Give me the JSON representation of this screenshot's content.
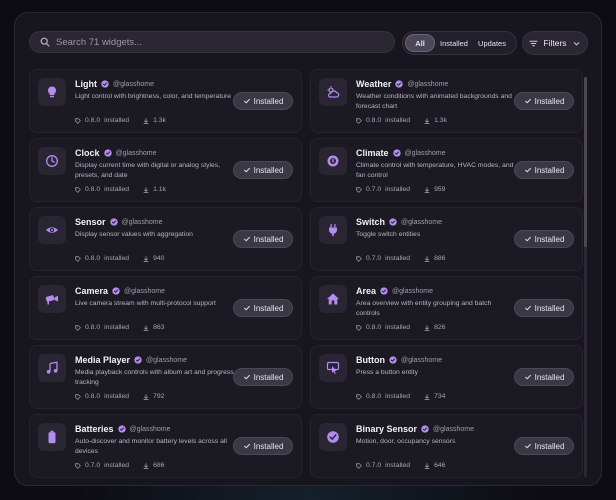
{
  "search": {
    "placeholder": "Search 71 widgets..."
  },
  "tabs": [
    {
      "label": "All",
      "active": true
    },
    {
      "label": "Installed",
      "active": false
    },
    {
      "label": "Updates",
      "active": false
    }
  ],
  "filters": {
    "label": "Filters"
  },
  "install_label": "Installed",
  "installed_word": "installed",
  "accent": "#b48cf0",
  "cards": [
    {
      "name": "Light",
      "author": "@glasshome",
      "icon": "lightbulb-icon",
      "desc": "Light control with brightness, color, and temperature",
      "version": "0.8.0",
      "downloads": "1.3k"
    },
    {
      "name": "Weather",
      "author": "@glasshome",
      "icon": "weather-icon",
      "desc": "Weather conditions with animated backgrounds and forecast chart",
      "version": "0.8.0",
      "downloads": "1.3k"
    },
    {
      "name": "Clock",
      "author": "@glasshome",
      "icon": "clock-icon",
      "desc": "Display current time with digital or analog styles, presets, and date",
      "version": "0.8.0",
      "downloads": "1.1k"
    },
    {
      "name": "Climate",
      "author": "@glasshome",
      "icon": "thermostat-icon",
      "desc": "Climate control with temperature, HVAC modes, and fan control",
      "version": "0.7.0",
      "downloads": "959"
    },
    {
      "name": "Sensor",
      "author": "@glasshome",
      "icon": "eye-icon",
      "desc": "Display sensor values with aggregation",
      "version": "0.8.0",
      "downloads": "940"
    },
    {
      "name": "Switch",
      "author": "@glasshome",
      "icon": "plug-icon",
      "desc": "Toggle switch entities",
      "version": "0.7.0",
      "downloads": "886"
    },
    {
      "name": "Camera",
      "author": "@glasshome",
      "icon": "camera-icon",
      "desc": "Live camera stream with multi-protocol support",
      "version": "0.8.0",
      "downloads": "863"
    },
    {
      "name": "Area",
      "author": "@glasshome",
      "icon": "home-icon",
      "desc": "Area overview with entity grouping and batch controls",
      "version": "0.8.0",
      "downloads": "826"
    },
    {
      "name": "Media Player",
      "author": "@glasshome",
      "icon": "music-icon",
      "desc": "Media playback controls with album art and progress tracking",
      "version": "0.8.0",
      "downloads": "792"
    },
    {
      "name": "Button",
      "author": "@glasshome",
      "icon": "button-icon",
      "desc": "Press a button entity",
      "version": "0.8.0",
      "downloads": "734"
    },
    {
      "name": "Batteries",
      "author": "@glasshome",
      "icon": "battery-icon",
      "desc": "Auto-discover and monitor battery levels across all devices",
      "version": "0.7.0",
      "downloads": "686"
    },
    {
      "name": "Binary Sensor",
      "author": "@glasshome",
      "icon": "check-circle-icon",
      "desc": "Motion, door, occupancy sensors",
      "version": "0.7.0",
      "downloads": "646"
    }
  ]
}
